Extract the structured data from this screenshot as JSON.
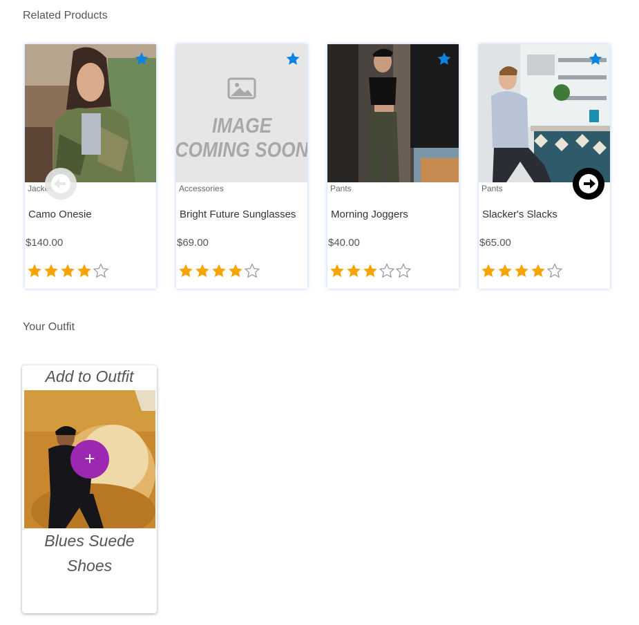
{
  "sections": {
    "related_title": "Related Products",
    "outfit_title": "Your Outfit"
  },
  "colors": {
    "favorite_star": "#0a84e0",
    "rating_star": "#f7a400",
    "add_button": "#9c27b0"
  },
  "related_products": [
    {
      "category": "Jackets",
      "name": "Camo Onesie",
      "price": "$140.00",
      "rating": 4
    },
    {
      "category": "Accessories",
      "name": "Bright Future Sunglasses",
      "price": "$69.00",
      "rating": 4,
      "placeholder_text": [
        "IMAGE",
        "COMING SOON"
      ]
    },
    {
      "category": "Pants",
      "name": "Morning Joggers",
      "price": "$40.00",
      "rating": 3
    },
    {
      "category": "Pants",
      "name": "Slacker's Slacks",
      "price": "$65.00",
      "rating": 4
    }
  ],
  "outfit": {
    "add_label": "Add to Outfit",
    "add_button_label": "+",
    "item_name_line1": "Blues Suede",
    "item_name_line2": "Shoes"
  }
}
